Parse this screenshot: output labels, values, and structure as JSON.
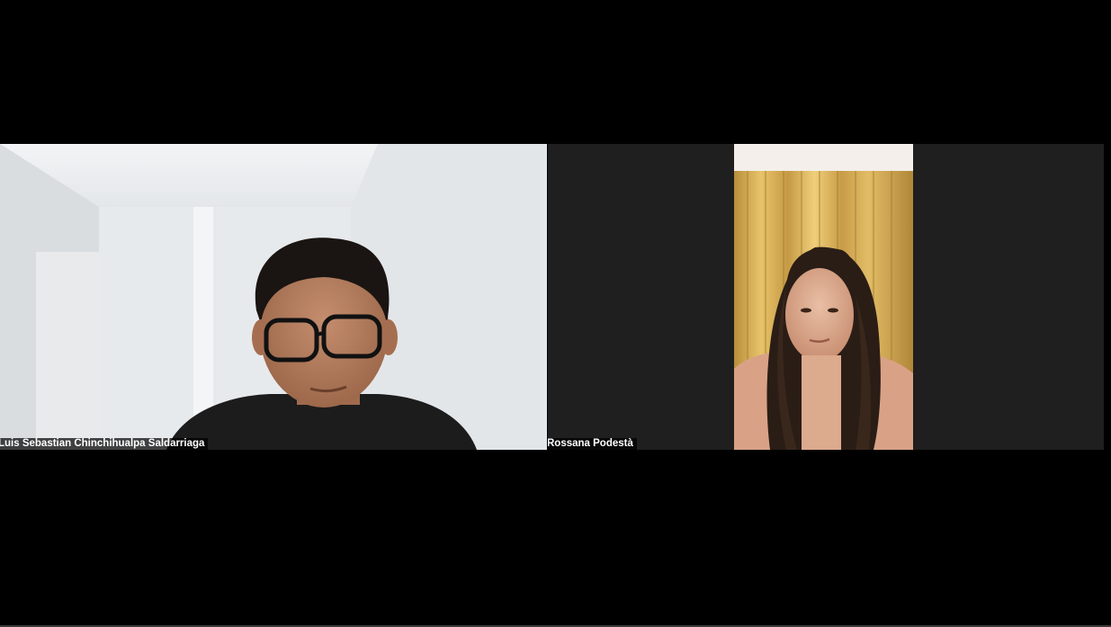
{
  "meeting": {
    "participants": [
      {
        "name": "Luis Sebastian Chinchihualpa Saldarriaga"
      },
      {
        "name": "Rossana Podestà"
      }
    ]
  },
  "colors": {
    "background": "#000000",
    "tile_dark": "#1f1f1f",
    "name_tag_bg": "rgba(0,0,0,0.72)",
    "name_tag_text": "#ffffff"
  }
}
